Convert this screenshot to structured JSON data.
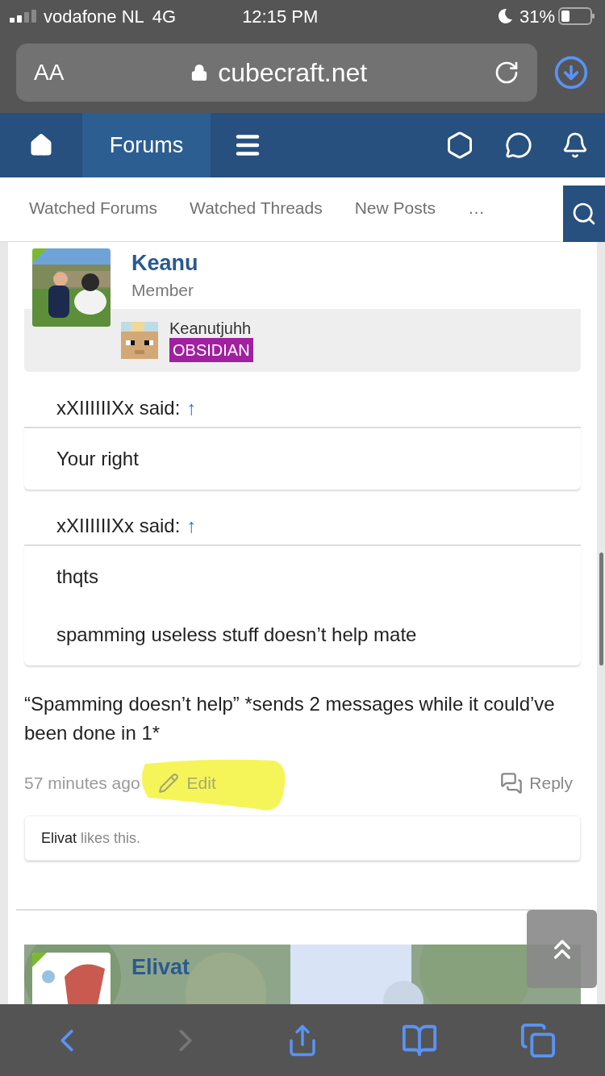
{
  "status_bar": {
    "carrier": "vodafone NL",
    "network": "4G",
    "time": "12:15 PM",
    "battery": "31%"
  },
  "address_bar": {
    "text_size": "AA",
    "url": "cubecraft.net"
  },
  "nav": {
    "tabs": [
      {
        "label": "Forums",
        "selected": true
      }
    ]
  },
  "sub_nav": {
    "links": [
      "Watched Forums",
      "Watched Threads",
      "New Posts",
      "…"
    ]
  },
  "post": {
    "author": "Keanu",
    "role": "Member",
    "ign": "Keanutjuhh",
    "rank": {
      "label": "OBSIDIAN",
      "color": "#a020a0"
    },
    "quotes": [
      {
        "author": "xXIIIIIIXx said:",
        "arrow": "↑",
        "lines": [
          "Your right"
        ]
      },
      {
        "author": "xXIIIIIIXx said:",
        "arrow": "↑",
        "lines": [
          "thqts",
          "spamming useless stuff doesn’t help mate"
        ]
      }
    ],
    "body": "“Spamming doesn’t help” *sends 2 messages while it could’ve been done in 1*",
    "time": "57 minutes ago",
    "edit": "Edit",
    "edit_highlighted": true,
    "reply": "Reply",
    "likes": {
      "user": "Elivat",
      "text": "likes this."
    }
  },
  "next_post": {
    "author": "Elivat"
  }
}
